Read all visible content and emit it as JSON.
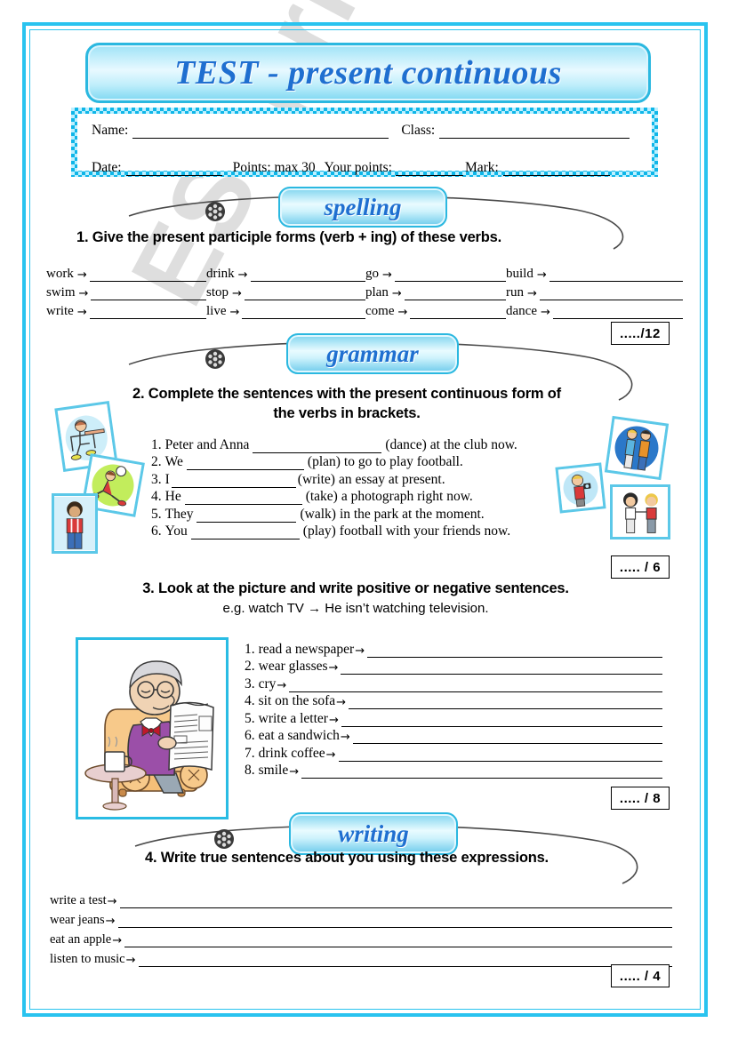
{
  "document": {
    "title": "TEST - present continuous",
    "watermark": "ESLprintables.com"
  },
  "info_box": {
    "name_label": "Name:",
    "class_label": "Class:",
    "date_label": "Date:",
    "points_label": "Points: max 30",
    "your_points_label": "Your points:",
    "mark_label": "Mark:"
  },
  "sections": [
    {
      "badge": "spelling"
    },
    {
      "badge": "grammar"
    },
    {
      "badge": "writing"
    }
  ],
  "exercise1": {
    "instruction": "1. Give the present participle forms (verb + ing) of these verbs.",
    "score": "...../12",
    "rows": [
      [
        "work",
        "drink",
        "go",
        "build"
      ],
      [
        "swim",
        "stop",
        "plan",
        "run"
      ],
      [
        "write",
        "live",
        "come",
        "dance"
      ]
    ]
  },
  "exercise2": {
    "instruction_line1": "2. Complete the sentences with the present continuous form of",
    "instruction_line2": "the verbs in brackets.",
    "score": "..... / 6",
    "items": [
      {
        "num": "1.",
        "subject": "Peter and Anna",
        "verb": "(dance)",
        "rest": "at the club now."
      },
      {
        "num": "2.",
        "subject": "We",
        "verb": "(plan)",
        "rest": "to go to play football."
      },
      {
        "num": "3.",
        "subject": "I",
        "verb": "(write)",
        "rest": "an essay at present."
      },
      {
        "num": "4.",
        "subject": "He",
        "verb": "(take)",
        "rest": "a photograph right now."
      },
      {
        "num": "5.",
        "subject": "They",
        "verb": "(walk)",
        "rest": "in the park at the moment."
      },
      {
        "num": "6.",
        "subject": "You",
        "verb": "(play)",
        "rest": "football with your friends now."
      }
    ]
  },
  "exercise3": {
    "instruction": "3. Look at the picture and write positive or negative sentences.",
    "example": "e.g. watch TV → He isn’t watching television.",
    "score": "..... / 8",
    "items": [
      {
        "num": "1.",
        "text": "read a newspaper"
      },
      {
        "num": "2.",
        "text": "wear glasses"
      },
      {
        "num": "3.",
        "text": "cry"
      },
      {
        "num": "4.",
        "text": "sit on the sofa"
      },
      {
        "num": "5.",
        "text": "write a letter"
      },
      {
        "num": "6.",
        "text": "eat a sandwich"
      },
      {
        "num": "7.",
        "text": "drink coffee"
      },
      {
        "num": "8.",
        "text": "smile"
      }
    ],
    "picture_description": "elderly-man-reading-newspaper-in-armchair"
  },
  "exercise4": {
    "instruction": "4. Write true sentences about you using these expressions.",
    "score": "..... / 4",
    "items": [
      {
        "text": "write a test"
      },
      {
        "text": "wear jeans"
      },
      {
        "text": "eat an apple"
      },
      {
        "text": "listen to music"
      }
    ]
  },
  "illustrations": {
    "left": [
      "person-at-desk-photo",
      "soccer-player-photo",
      "standing-person-photo"
    ],
    "right": [
      "two-people-walking-photo",
      "person-with-camera-photo",
      "two-people-holding-hands-photo"
    ]
  },
  "colors": {
    "accent": "#29c3ef",
    "title_text": "#1f6fd0",
    "border": "#2bb8e0"
  },
  "symbols": {
    "arrow": "→"
  }
}
